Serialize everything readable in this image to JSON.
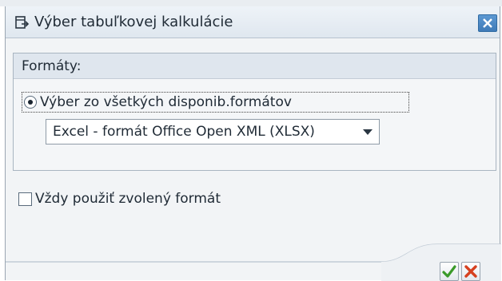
{
  "window": {
    "title": "Výber tabuľkovej kalkulácie",
    "title_icon": "table-export-icon",
    "close_icon": "close-icon",
    "accent_color": "#3f7bb8"
  },
  "formats_group": {
    "title": "Formáty:",
    "radio_option": {
      "label": "Výber zo všetkých disponib.formátov",
      "selected": true
    },
    "format_select": {
      "value": "Excel - formát Office Open XML (XLSX)"
    }
  },
  "always_use": {
    "label": "Vždy použiť zvolený formát",
    "checked": false
  },
  "footer": {
    "confirm_icon": "checkmark-icon",
    "cancel_icon": "cancel-x-icon",
    "confirm_color": "#3a9a2a",
    "cancel_color": "#d6401f"
  }
}
